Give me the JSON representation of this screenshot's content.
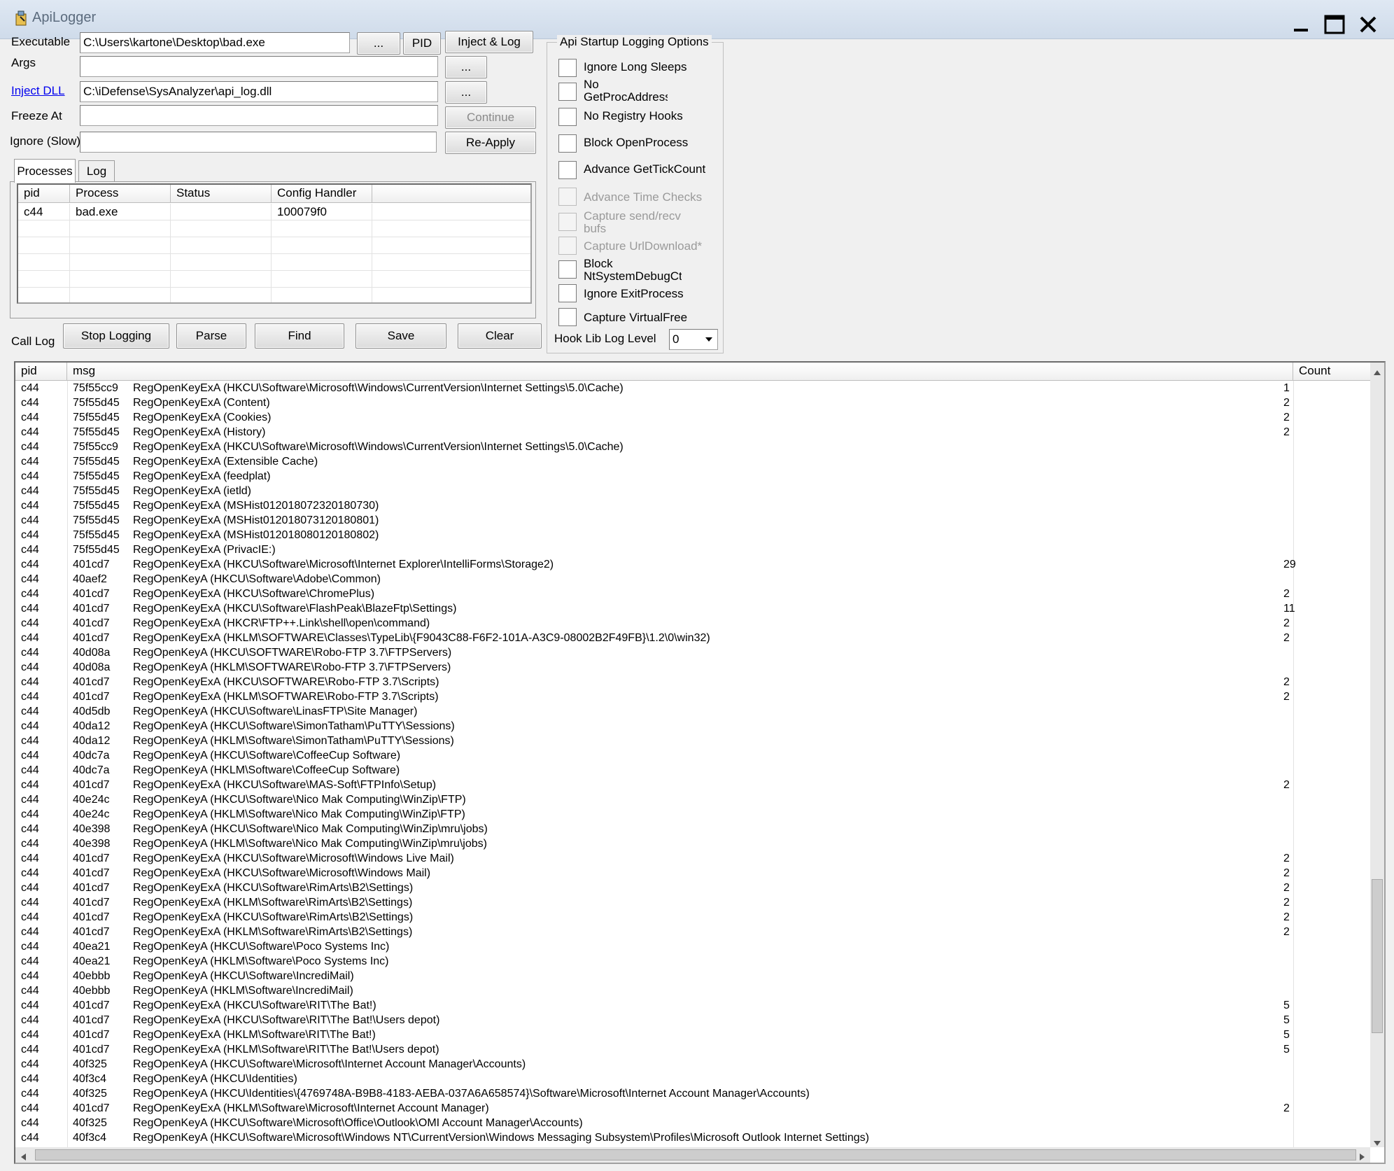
{
  "window": {
    "title": "ApiLogger",
    "minimize_icon": "minimize-icon",
    "maximize_icon": "maximize-icon",
    "close_icon": "close-icon"
  },
  "form": {
    "executable_label": "Executable",
    "executable_value": "C:\\Users\\kartone\\Desktop\\bad.exe",
    "browse_label": "...",
    "pid_label": "PID",
    "inject_log_label": "Inject & Log",
    "args_label": "Args",
    "args_value": "",
    "inject_dll_label": "Inject DLL",
    "inject_dll_value": "C:\\iDefense\\SysAnalyzer\\api_log.dll",
    "freeze_at_label": "Freeze At",
    "freeze_at_value": "",
    "continue_label": "Continue",
    "ignore_slow_label": "Ignore (Slow)",
    "ignore_slow_value": "",
    "reapply_label": "Re-Apply"
  },
  "tabs": [
    {
      "label": "Processes",
      "active": true
    },
    {
      "label": "Log",
      "active": false
    }
  ],
  "processes": {
    "columns": [
      "pid",
      "Process",
      "Status",
      "Config Handler"
    ],
    "rows": [
      {
        "pid": "c44",
        "process": "bad.exe",
        "status": "",
        "config_handler": "100079f0"
      }
    ]
  },
  "options": {
    "title": "Api Startup Logging Options",
    "items": [
      {
        "label": "Ignore Long Sleeps",
        "enabled": true,
        "checked": false
      },
      {
        "label": "No GetProcAddress",
        "enabled": true,
        "checked": false
      },
      {
        "label": "No Registry Hooks",
        "enabled": true,
        "checked": false
      },
      {
        "label": "Block OpenProcess",
        "enabled": true,
        "checked": false
      },
      {
        "label": "Advance GetTickCount",
        "enabled": true,
        "checked": false
      },
      {
        "label": "Advance Time Checks",
        "enabled": false,
        "checked": false
      },
      {
        "label": "Capture send/recv bufs",
        "enabled": false,
        "checked": false
      },
      {
        "label": "Capture UrlDownload*",
        "enabled": false,
        "checked": false
      },
      {
        "label": "Block NtSystemDebugCtl",
        "enabled": true,
        "checked": false
      },
      {
        "label": "Ignore ExitProcess",
        "enabled": true,
        "checked": false
      },
      {
        "label": "Capture VirtualFree",
        "enabled": true,
        "checked": false
      }
    ],
    "hook_level_label": "Hook Lib Log Level",
    "hook_level_value": "0"
  },
  "call_log": {
    "label": "Call Log",
    "buttons": {
      "stop": "Stop Logging",
      "parse": "Parse",
      "find": "Find",
      "save": "Save",
      "clear": "Clear"
    },
    "columns": [
      "pid",
      "msg",
      "Count"
    ],
    "rows": [
      {
        "pid": "c44",
        "addr": "75f55cc9",
        "msg": "RegOpenKeyExA (HKCU\\Software\\Microsoft\\Windows\\CurrentVersion\\Internet Settings\\5.0\\Cache)",
        "count": "1"
      },
      {
        "pid": "c44",
        "addr": "75f55d45",
        "msg": "RegOpenKeyExA (Content)",
        "count": "2"
      },
      {
        "pid": "c44",
        "addr": "75f55d45",
        "msg": "RegOpenKeyExA (Cookies)",
        "count": "2"
      },
      {
        "pid": "c44",
        "addr": "75f55d45",
        "msg": "RegOpenKeyExA (History)",
        "count": "2"
      },
      {
        "pid": "c44",
        "addr": "75f55cc9",
        "msg": "RegOpenKeyExA (HKCU\\Software\\Microsoft\\Windows\\CurrentVersion\\Internet Settings\\5.0\\Cache)",
        "count": ""
      },
      {
        "pid": "c44",
        "addr": "75f55d45",
        "msg": "RegOpenKeyExA (Extensible Cache)",
        "count": ""
      },
      {
        "pid": "c44",
        "addr": "75f55d45",
        "msg": "RegOpenKeyExA (feedplat)",
        "count": ""
      },
      {
        "pid": "c44",
        "addr": "75f55d45",
        "msg": "RegOpenKeyExA (ietld)",
        "count": ""
      },
      {
        "pid": "c44",
        "addr": "75f55d45",
        "msg": "RegOpenKeyExA (MSHist012018072320180730)",
        "count": ""
      },
      {
        "pid": "c44",
        "addr": "75f55d45",
        "msg": "RegOpenKeyExA (MSHist012018073120180801)",
        "count": ""
      },
      {
        "pid": "c44",
        "addr": "75f55d45",
        "msg": "RegOpenKeyExA (MSHist012018080120180802)",
        "count": ""
      },
      {
        "pid": "c44",
        "addr": "75f55d45",
        "msg": "RegOpenKeyExA (PrivacIE:)",
        "count": ""
      },
      {
        "pid": "c44",
        "addr": "401cd7",
        "msg": "RegOpenKeyExA (HKCU\\Software\\Microsoft\\Internet Explorer\\IntelliForms\\Storage2)",
        "count": "29"
      },
      {
        "pid": "c44",
        "addr": "40aef2",
        "msg": "RegOpenKeyA (HKCU\\Software\\Adobe\\Common)",
        "count": ""
      },
      {
        "pid": "c44",
        "addr": "401cd7",
        "msg": "RegOpenKeyExA (HKCU\\Software\\ChromePlus)",
        "count": "2"
      },
      {
        "pid": "c44",
        "addr": "401cd7",
        "msg": "RegOpenKeyExA (HKCU\\Software\\FlashPeak\\BlazeFtp\\Settings)",
        "count": "11"
      },
      {
        "pid": "c44",
        "addr": "401cd7",
        "msg": "RegOpenKeyExA (HKCR\\FTP++.Link\\shell\\open\\command)",
        "count": "2"
      },
      {
        "pid": "c44",
        "addr": "401cd7",
        "msg": "RegOpenKeyExA (HKLM\\SOFTWARE\\Classes\\TypeLib\\{F9043C88-F6F2-101A-A3C9-08002B2F49FB}\\1.2\\0\\win32)",
        "count": "2"
      },
      {
        "pid": "c44",
        "addr": "40d08a",
        "msg": "RegOpenKeyA (HKCU\\SOFTWARE\\Robo-FTP 3.7\\FTPServers)",
        "count": ""
      },
      {
        "pid": "c44",
        "addr": "40d08a",
        "msg": "RegOpenKeyA (HKLM\\SOFTWARE\\Robo-FTP 3.7\\FTPServers)",
        "count": ""
      },
      {
        "pid": "c44",
        "addr": "401cd7",
        "msg": "RegOpenKeyExA (HKCU\\SOFTWARE\\Robo-FTP 3.7\\Scripts)",
        "count": "2"
      },
      {
        "pid": "c44",
        "addr": "401cd7",
        "msg": "RegOpenKeyExA (HKLM\\SOFTWARE\\Robo-FTP 3.7\\Scripts)",
        "count": "2"
      },
      {
        "pid": "c44",
        "addr": "40d5db",
        "msg": "RegOpenKeyA (HKCU\\Software\\LinasFTP\\Site Manager)",
        "count": ""
      },
      {
        "pid": "c44",
        "addr": "40da12",
        "msg": "RegOpenKeyA (HKCU\\Software\\SimonTatham\\PuTTY\\Sessions)",
        "count": ""
      },
      {
        "pid": "c44",
        "addr": "40da12",
        "msg": "RegOpenKeyA (HKLM\\Software\\SimonTatham\\PuTTY\\Sessions)",
        "count": ""
      },
      {
        "pid": "c44",
        "addr": "40dc7a",
        "msg": "RegOpenKeyA (HKCU\\Software\\CoffeeCup Software)",
        "count": ""
      },
      {
        "pid": "c44",
        "addr": "40dc7a",
        "msg": "RegOpenKeyA (HKLM\\Software\\CoffeeCup Software)",
        "count": ""
      },
      {
        "pid": "c44",
        "addr": "401cd7",
        "msg": "RegOpenKeyExA (HKCU\\Software\\MAS-Soft\\FTPInfo\\Setup)",
        "count": "2"
      },
      {
        "pid": "c44",
        "addr": "40e24c",
        "msg": "RegOpenKeyA (HKCU\\Software\\Nico Mak Computing\\WinZip\\FTP)",
        "count": ""
      },
      {
        "pid": "c44",
        "addr": "40e24c",
        "msg": "RegOpenKeyA (HKLM\\Software\\Nico Mak Computing\\WinZip\\FTP)",
        "count": ""
      },
      {
        "pid": "c44",
        "addr": "40e398",
        "msg": "RegOpenKeyA (HKCU\\Software\\Nico Mak Computing\\WinZip\\mru\\jobs)",
        "count": ""
      },
      {
        "pid": "c44",
        "addr": "40e398",
        "msg": "RegOpenKeyA (HKLM\\Software\\Nico Mak Computing\\WinZip\\mru\\jobs)",
        "count": ""
      },
      {
        "pid": "c44",
        "addr": "401cd7",
        "msg": "RegOpenKeyExA (HKCU\\Software\\Microsoft\\Windows Live Mail)",
        "count": "2"
      },
      {
        "pid": "c44",
        "addr": "401cd7",
        "msg": "RegOpenKeyExA (HKCU\\Software\\Microsoft\\Windows Mail)",
        "count": "2"
      },
      {
        "pid": "c44",
        "addr": "401cd7",
        "msg": "RegOpenKeyExA (HKCU\\Software\\RimArts\\B2\\Settings)",
        "count": "2"
      },
      {
        "pid": "c44",
        "addr": "401cd7",
        "msg": "RegOpenKeyExA (HKLM\\Software\\RimArts\\B2\\Settings)",
        "count": "2"
      },
      {
        "pid": "c44",
        "addr": "401cd7",
        "msg": "RegOpenKeyExA (HKCU\\Software\\RimArts\\B2\\Settings)",
        "count": "2"
      },
      {
        "pid": "c44",
        "addr": "401cd7",
        "msg": "RegOpenKeyExA (HKLM\\Software\\RimArts\\B2\\Settings)",
        "count": "2"
      },
      {
        "pid": "c44",
        "addr": "40ea21",
        "msg": "RegOpenKeyA (HKCU\\Software\\Poco Systems Inc)",
        "count": ""
      },
      {
        "pid": "c44",
        "addr": "40ea21",
        "msg": "RegOpenKeyA (HKLM\\Software\\Poco Systems Inc)",
        "count": ""
      },
      {
        "pid": "c44",
        "addr": "40ebbb",
        "msg": "RegOpenKeyA (HKCU\\Software\\IncrediMail)",
        "count": ""
      },
      {
        "pid": "c44",
        "addr": "40ebbb",
        "msg": "RegOpenKeyA (HKLM\\Software\\IncrediMail)",
        "count": ""
      },
      {
        "pid": "c44",
        "addr": "401cd7",
        "msg": "RegOpenKeyExA (HKCU\\Software\\RIT\\The Bat!)",
        "count": "5"
      },
      {
        "pid": "c44",
        "addr": "401cd7",
        "msg": "RegOpenKeyExA (HKCU\\Software\\RIT\\The Bat!\\Users depot)",
        "count": "5"
      },
      {
        "pid": "c44",
        "addr": "401cd7",
        "msg": "RegOpenKeyExA (HKLM\\Software\\RIT\\The Bat!)",
        "count": "5"
      },
      {
        "pid": "c44",
        "addr": "401cd7",
        "msg": "RegOpenKeyExA (HKLM\\Software\\RIT\\The Bat!\\Users depot)",
        "count": "5"
      },
      {
        "pid": "c44",
        "addr": "40f325",
        "msg": "RegOpenKeyA (HKCU\\Software\\Microsoft\\Internet Account Manager\\Accounts)",
        "count": ""
      },
      {
        "pid": "c44",
        "addr": "40f3c4",
        "msg": "RegOpenKeyA (HKCU\\Identities)",
        "count": ""
      },
      {
        "pid": "c44",
        "addr": "40f325",
        "msg": "RegOpenKeyA (HKCU\\Identities\\{4769748A-B9B8-4183-AEBA-037A6A658574}\\Software\\Microsoft\\Internet Account Manager\\Accounts)",
        "count": ""
      },
      {
        "pid": "c44",
        "addr": "401cd7",
        "msg": "RegOpenKeyExA (HKLM\\Software\\Microsoft\\Internet Account Manager)",
        "count": "2"
      },
      {
        "pid": "c44",
        "addr": "40f325",
        "msg": "RegOpenKeyA (HKCU\\Software\\Microsoft\\Office\\Outlook\\OMI Account Manager\\Accounts)",
        "count": ""
      },
      {
        "pid": "c44",
        "addr": "40f3c4",
        "msg": "RegOpenKeyA (HKCU\\Software\\Microsoft\\Windows NT\\CurrentVersion\\Windows Messaging Subsystem\\Profiles\\Microsoft Outlook Internet Settings)",
        "count": ""
      }
    ]
  }
}
